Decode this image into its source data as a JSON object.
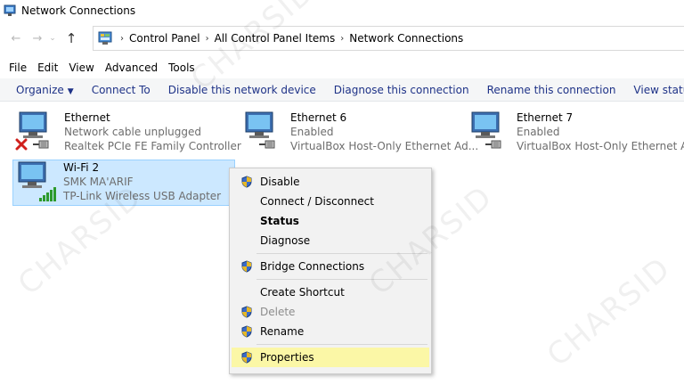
{
  "window": {
    "title": "Network Connections"
  },
  "nav": {
    "back_icon": "arrow-left-icon",
    "forward_icon": "arrow-right-icon",
    "recent_icon": "chevron-down-icon",
    "up_icon": "arrow-up-icon"
  },
  "address": {
    "crumbs": [
      "Control Panel",
      "All Control Panel Items",
      "Network Connections"
    ]
  },
  "menubar": {
    "items": [
      "File",
      "Edit",
      "View",
      "Advanced",
      "Tools"
    ]
  },
  "toolbar": {
    "items": [
      "Organize",
      "Connect To",
      "Disable this network device",
      "Diagnose this connection",
      "Rename this connection",
      "View status of"
    ]
  },
  "adapters": [
    {
      "name": "Ethernet",
      "status": "Network cable unplugged",
      "device": "Realtek PCIe FE Family Controller",
      "badge": "red-x-icon"
    },
    {
      "name": "Ethernet 6",
      "status": "Enabled",
      "device": "VirtualBox Host-Only Ethernet Ad...",
      "badge": "ethernet-plug-icon"
    },
    {
      "name": "Ethernet 7",
      "status": "Enabled",
      "device": "VirtualBox Host-Only Ethernet Ad...",
      "badge": "ethernet-plug-icon"
    },
    {
      "name": "Wi-Fi 2",
      "status": "SMK MA'ARIF",
      "device": "TP-Link Wireless USB Adapter",
      "badge": "wifi-signal-icon"
    }
  ],
  "context_menu": {
    "items": [
      {
        "label": "Disable",
        "shield": true,
        "style": "normal"
      },
      {
        "label": "Connect / Disconnect",
        "shield": false,
        "style": "normal"
      },
      {
        "label": "Status",
        "shield": false,
        "style": "bold"
      },
      {
        "label": "Diagnose",
        "shield": false,
        "style": "normal"
      },
      {
        "label": "Bridge Connections",
        "shield": true,
        "style": "normal"
      },
      {
        "label": "Create Shortcut",
        "shield": false,
        "style": "normal"
      },
      {
        "label": "Delete",
        "shield": true,
        "style": "disabled"
      },
      {
        "label": "Rename",
        "shield": true,
        "style": "normal"
      },
      {
        "label": "Properties",
        "shield": true,
        "style": "highlighted"
      }
    ]
  },
  "watermark": {
    "text": "CHARSID"
  },
  "colors": {
    "toolbar_text": "#1e3287",
    "selection_bg": "#cce8ff",
    "highlight_bg": "#fbf7a6"
  }
}
